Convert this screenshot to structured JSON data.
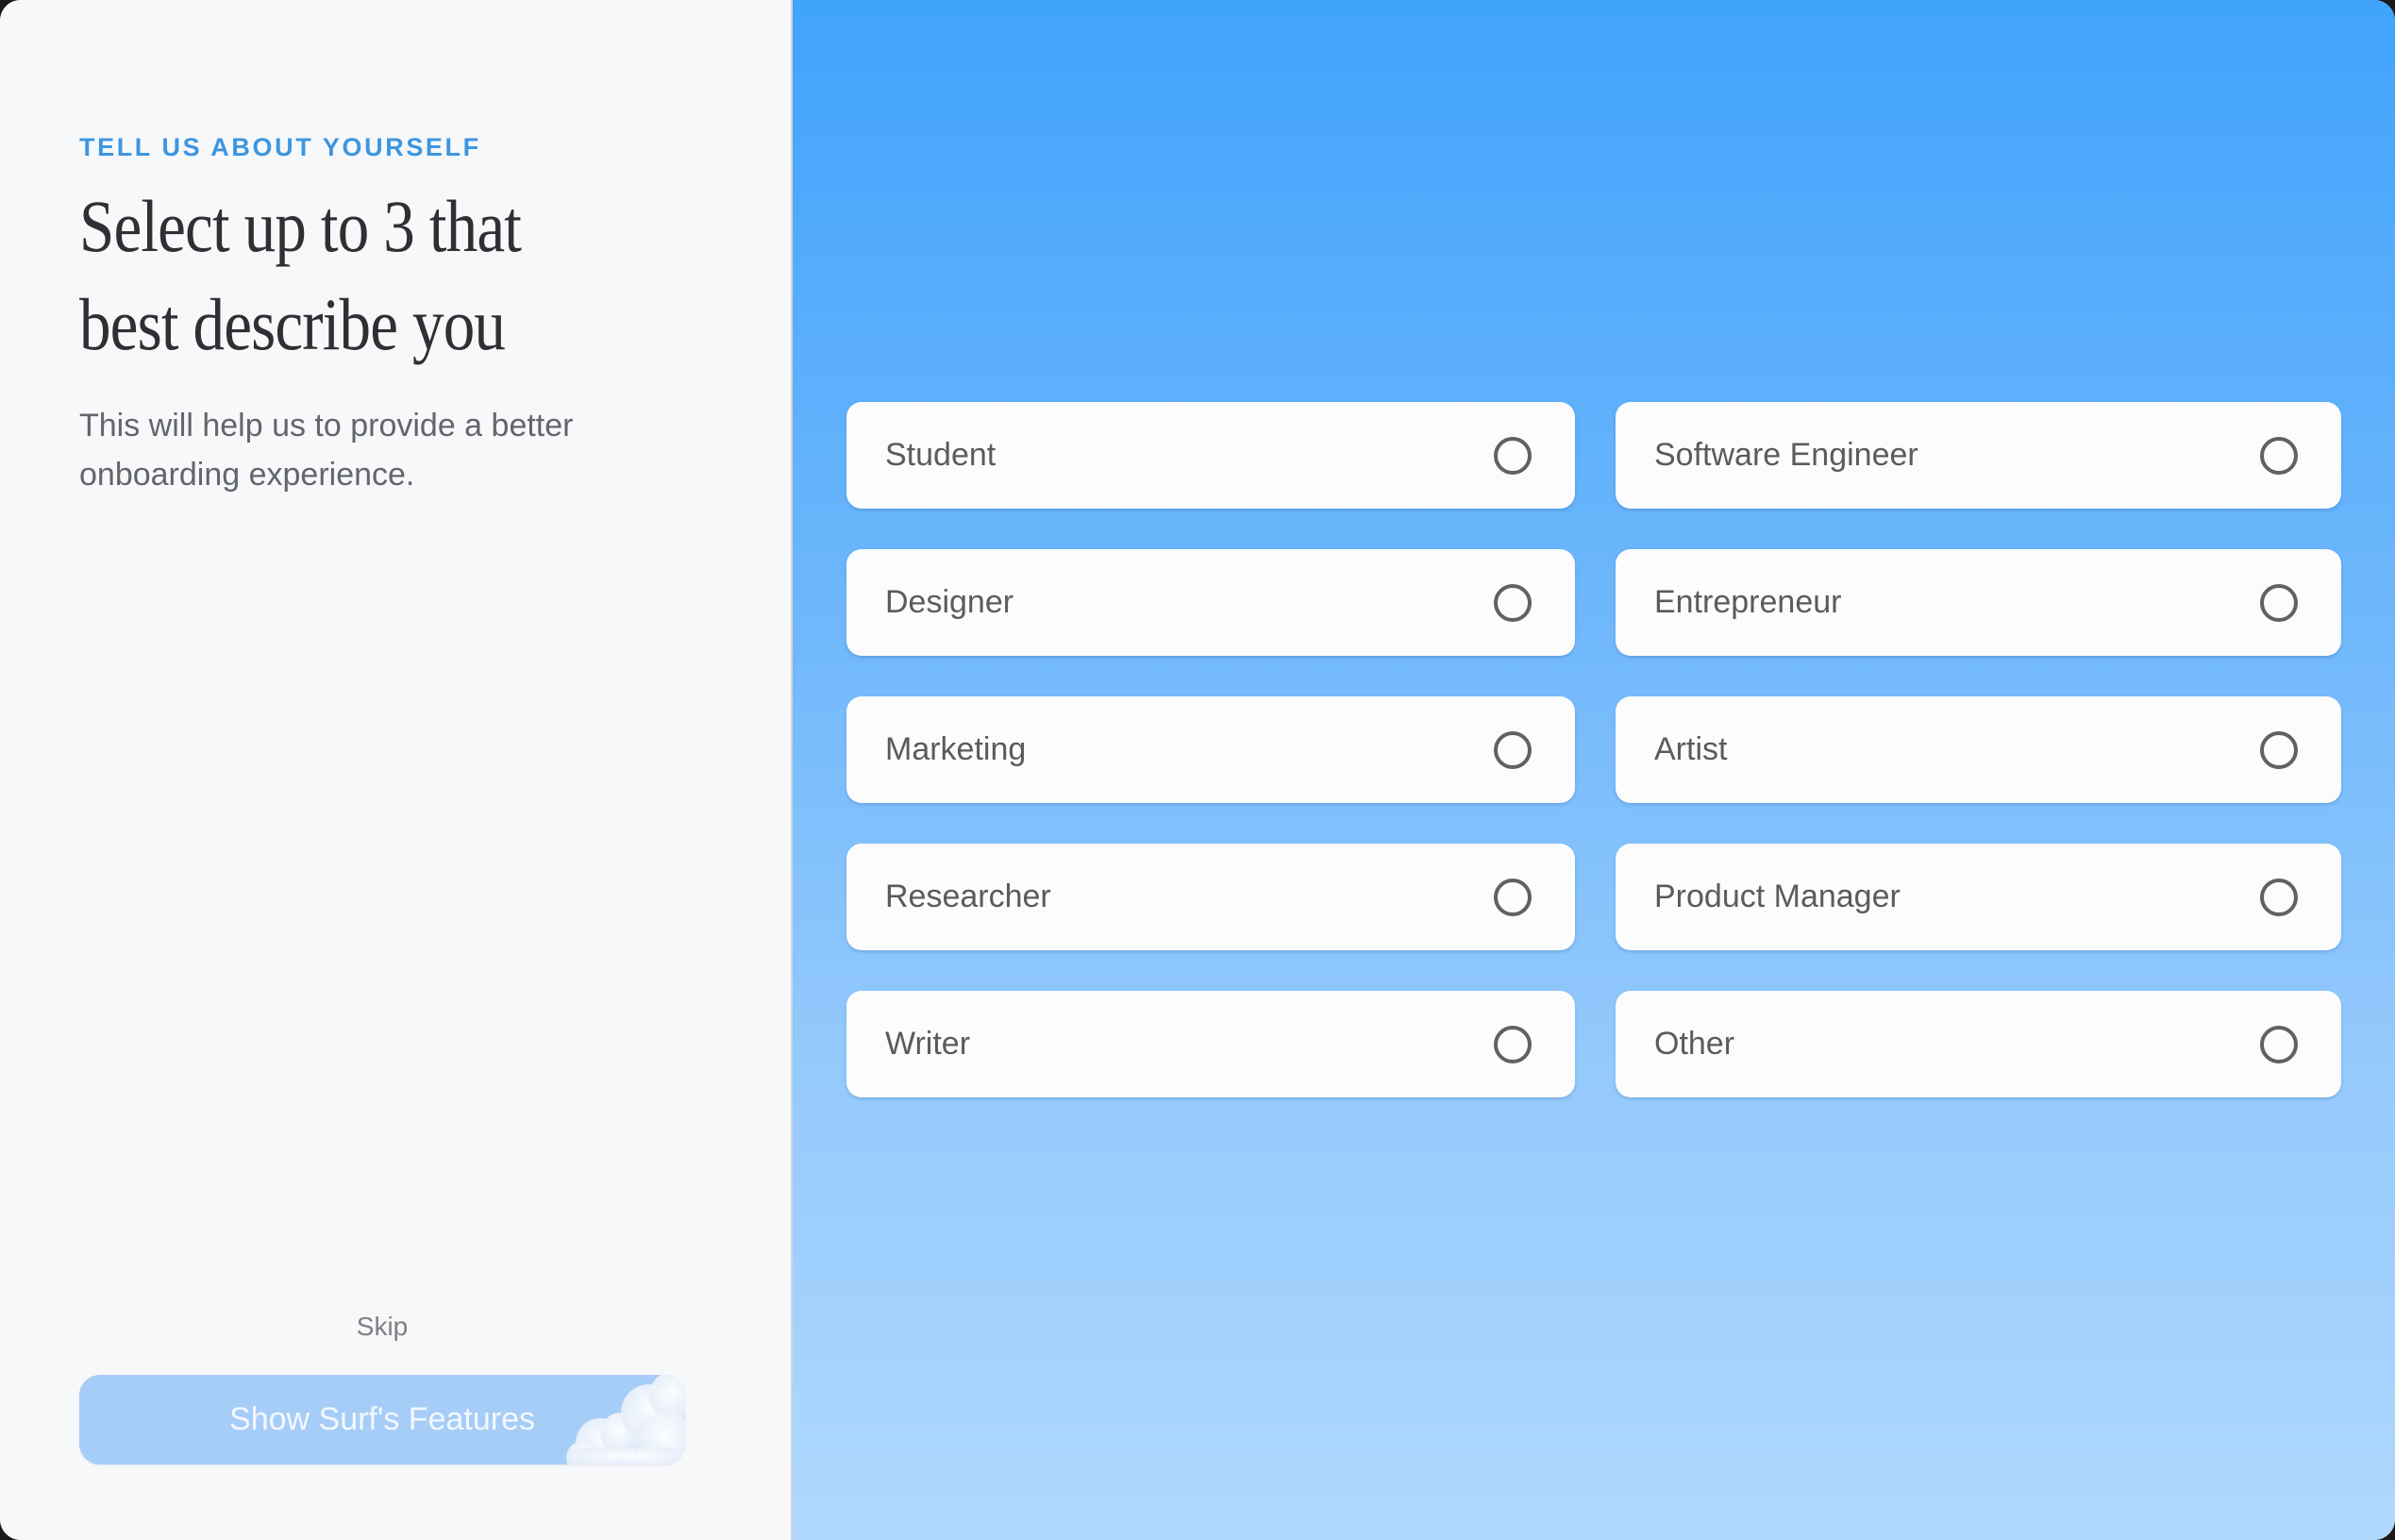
{
  "left": {
    "eyebrow": "TELL US ABOUT YOURSELF",
    "heading_lines": [
      "Select up to 3 that",
      "best describe you"
    ],
    "subtext": "This will help us to provide a better onboarding experience.",
    "skip_label": "Skip",
    "cta_label": "Show Surf's Features"
  },
  "options": [
    {
      "label": "Student",
      "selected": false
    },
    {
      "label": "Software Engineer",
      "selected": false
    },
    {
      "label": "Designer",
      "selected": false
    },
    {
      "label": "Entrepreneur",
      "selected": false
    },
    {
      "label": "Marketing",
      "selected": false
    },
    {
      "label": "Artist",
      "selected": false
    },
    {
      "label": "Researcher",
      "selected": false
    },
    {
      "label": "Product Manager",
      "selected": false
    },
    {
      "label": "Writer",
      "selected": false
    },
    {
      "label": "Other",
      "selected": false
    }
  ],
  "colors": {
    "accent": "#3d96e0",
    "gradient_top": "#40a3fc",
    "gradient_bottom": "#b0d8fe",
    "cta_background": "#a6cdf7"
  },
  "icons": {
    "radio": "radio-unchecked-icon",
    "cloud": "cloud-icon"
  }
}
